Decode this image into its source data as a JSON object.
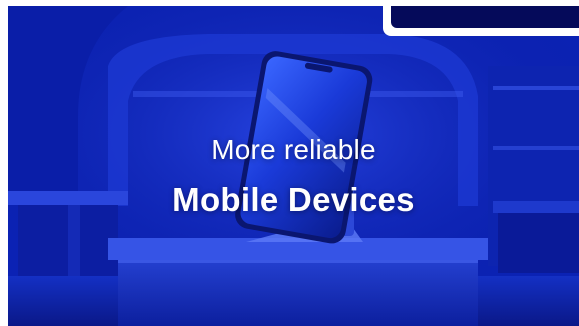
{
  "hero": {
    "headline_line1": "More reliable",
    "headline_line2": "Mobile Devices",
    "image_subject": "smartphone-on-wireless-charging-stand",
    "colors": {
      "overlay_blue": "#0b23b8",
      "corner_panel": "#050a5a",
      "text": "#ffffff"
    }
  }
}
